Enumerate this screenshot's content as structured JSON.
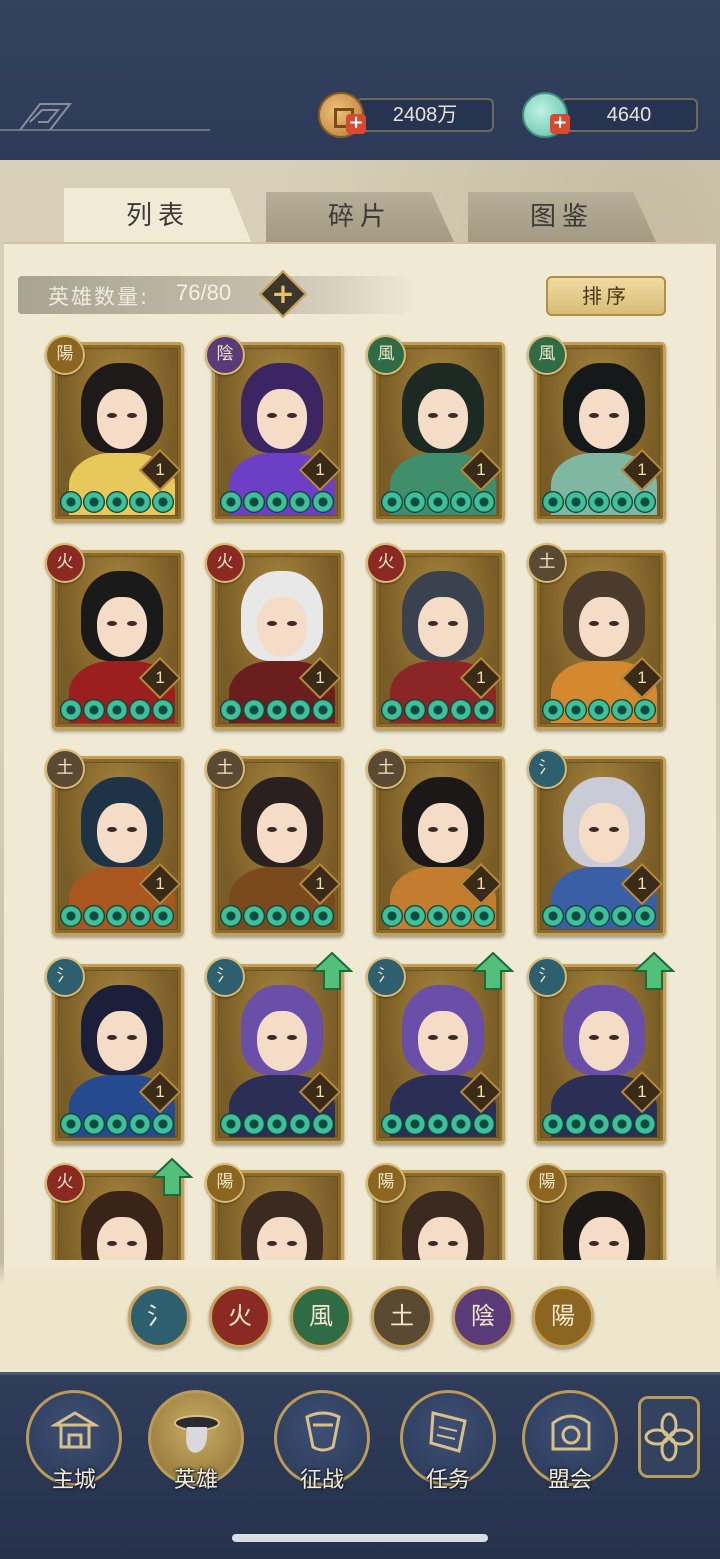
{
  "currency": {
    "coins": "2408万",
    "jade": "4640",
    "coin_icon": "coin-icon",
    "jade_icon": "jade-icon"
  },
  "tabs": [
    {
      "label": "列表",
      "active": true
    },
    {
      "label": "碎片",
      "active": false
    },
    {
      "label": "图鉴",
      "active": false
    }
  ],
  "hero_count": {
    "label": "英雄数量:",
    "value": "76/80"
  },
  "sort_label": "排序",
  "element_glyphs": {
    "water": "氵",
    "fire": "火",
    "wind": "風",
    "earth": "土",
    "yin": "陰",
    "yang": "陽"
  },
  "element_colors": {
    "water": "#2e5f6e",
    "fire": "#8a2a22",
    "wind": "#2f6b45",
    "earth": "#5a4a33",
    "yin": "#5b3a78",
    "yang": "#8c6520"
  },
  "heroes": [
    {
      "element": "yang",
      "glyph": "陽",
      "level": "1",
      "stars": 5,
      "upgrade": false,
      "hair": "#1e1a1a",
      "body": "#e7c85b"
    },
    {
      "element": "yin",
      "glyph": "陰",
      "level": "1",
      "stars": 5,
      "upgrade": false,
      "hair": "#3b2563",
      "body": "#6c3fc4"
    },
    {
      "element": "wind",
      "glyph": "風",
      "level": "1",
      "stars": 5,
      "upgrade": false,
      "hair": "#1d2a24",
      "body": "#3f8f6c"
    },
    {
      "element": "wind",
      "glyph": "風",
      "level": "1",
      "stars": 5,
      "upgrade": false,
      "hair": "#15191a",
      "body": "#7fb7a3"
    },
    {
      "element": "fire",
      "glyph": "火",
      "level": "1",
      "stars": 5,
      "upgrade": false,
      "hair": "#1a1a1a",
      "body": "#9b1f1f"
    },
    {
      "element": "fire",
      "glyph": "火",
      "level": "1",
      "stars": 5,
      "upgrade": false,
      "hair": "#e8e8e8",
      "body": "#6b1e1e"
    },
    {
      "element": "fire",
      "glyph": "火",
      "level": "1",
      "stars": 5,
      "upgrade": false,
      "hair": "#3a4250",
      "body": "#8c2525"
    },
    {
      "element": "earth",
      "glyph": "土",
      "level": "1",
      "stars": 5,
      "upgrade": false,
      "hair": "#4a3b2c",
      "body": "#d4892f"
    },
    {
      "element": "earth",
      "glyph": "土",
      "level": "1",
      "stars": 5,
      "upgrade": false,
      "hair": "#1f3346",
      "body": "#a9561f"
    },
    {
      "element": "earth",
      "glyph": "土",
      "level": "1",
      "stars": 5,
      "upgrade": false,
      "hair": "#2a2020",
      "body": "#7a4a1d"
    },
    {
      "element": "earth",
      "glyph": "土",
      "level": "1",
      "stars": 5,
      "upgrade": false,
      "hair": "#1c1818",
      "body": "#c47d2e"
    },
    {
      "element": "water",
      "glyph": "氵",
      "level": "1",
      "stars": 5,
      "upgrade": false,
      "hair": "#c9ccd6",
      "body": "#3b5fa6"
    },
    {
      "element": "water",
      "glyph": "氵",
      "level": "1",
      "stars": 5,
      "upgrade": false,
      "hair": "#1b1f3a",
      "body": "#264a8f"
    },
    {
      "element": "water",
      "glyph": "氵",
      "level": "1",
      "stars": 5,
      "upgrade": true,
      "hair": "#6a4fa8",
      "body": "#2b2f55"
    },
    {
      "element": "water",
      "glyph": "氵",
      "level": "1",
      "stars": 5,
      "upgrade": true,
      "hair": "#6a4fa8",
      "body": "#2b2f55"
    },
    {
      "element": "water",
      "glyph": "氵",
      "level": "1",
      "stars": 5,
      "upgrade": true,
      "hair": "#6a4fa8",
      "body": "#2b2f55"
    },
    {
      "element": "fire",
      "glyph": "火",
      "level": "",
      "stars": 0,
      "upgrade": true,
      "hair": "#3a2418",
      "body": "#6a2a22"
    },
    {
      "element": "yang",
      "glyph": "陽",
      "level": "",
      "stars": 0,
      "upgrade": false,
      "hair": "#3a2a20",
      "body": "#4a4a3a"
    },
    {
      "element": "yang",
      "glyph": "陽",
      "level": "",
      "stars": 0,
      "upgrade": false,
      "hair": "#3a2a20",
      "body": "#4a4a3a"
    },
    {
      "element": "yang",
      "glyph": "陽",
      "level": "",
      "stars": 0,
      "upgrade": false,
      "hair": "#1c1816",
      "body": "#3a3028"
    }
  ],
  "element_filters": [
    {
      "element": "water",
      "glyph": "氵"
    },
    {
      "element": "fire",
      "glyph": "火"
    },
    {
      "element": "wind",
      "glyph": "風"
    },
    {
      "element": "earth",
      "glyph": "土"
    },
    {
      "element": "yin",
      "glyph": "陰"
    },
    {
      "element": "yang",
      "glyph": "陽"
    }
  ],
  "nav": [
    {
      "label": "主城",
      "icon": "palace-icon",
      "active": false
    },
    {
      "label": "英雄",
      "icon": "hero-portrait-icon",
      "active": true
    },
    {
      "label": "征战",
      "icon": "battle-icon",
      "active": false
    },
    {
      "label": "任务",
      "icon": "scroll-icon",
      "active": false
    },
    {
      "label": "盟会",
      "icon": "alliance-icon",
      "active": false
    }
  ],
  "menu_icon": "flower-menu-icon"
}
